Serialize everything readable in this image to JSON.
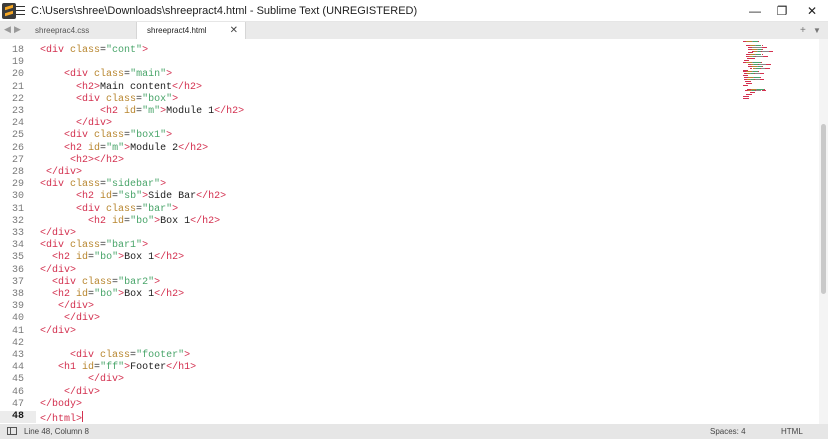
{
  "window": {
    "title": "C:\\Users\\shree\\Downloads\\shreepract4.html - Sublime Text (UNREGISTERED)",
    "minimize": "—",
    "maximize": "❐",
    "close": "✕"
  },
  "tabs": [
    {
      "label": "shreeprac4.css",
      "close": "",
      "active": false
    },
    {
      "label": "shreepract4.html",
      "close": "✕",
      "active": true
    }
  ],
  "tab_nav": {
    "prev": "◀",
    "next": "▶",
    "add": "+",
    "menu": "▼"
  },
  "editor": {
    "current_line": 48,
    "lines": [
      {
        "n": "18",
        "tokens": [
          [
            "tag",
            "<div"
          ],
          [
            "attr",
            " class"
          ],
          [
            "punc",
            "="
          ],
          [
            "str",
            "\"cont\""
          ],
          [
            "tag",
            ">"
          ]
        ]
      },
      {
        "n": "19",
        "tokens": []
      },
      {
        "n": "20",
        "tokens": [
          [
            "text",
            "    "
          ],
          [
            "tag",
            "<div"
          ],
          [
            "attr",
            " class"
          ],
          [
            "punc",
            "="
          ],
          [
            "str",
            "\"main\""
          ],
          [
            "tag",
            ">"
          ]
        ]
      },
      {
        "n": "21",
        "tokens": [
          [
            "text",
            "      "
          ],
          [
            "tag",
            "<h2>"
          ],
          [
            "text",
            "Main content"
          ],
          [
            "tag",
            "</h2>"
          ]
        ]
      },
      {
        "n": "22",
        "tokens": [
          [
            "text",
            "      "
          ],
          [
            "tag",
            "<div"
          ],
          [
            "attr",
            " class"
          ],
          [
            "punc",
            "="
          ],
          [
            "str",
            "\"box\""
          ],
          [
            "tag",
            ">"
          ]
        ]
      },
      {
        "n": "23",
        "tokens": [
          [
            "text",
            "          "
          ],
          [
            "tag",
            "<h2"
          ],
          [
            "attr",
            " id"
          ],
          [
            "punc",
            "="
          ],
          [
            "str",
            "\"m\""
          ],
          [
            "tag",
            ">"
          ],
          [
            "text",
            "Module 1"
          ],
          [
            "tag",
            "</h2>"
          ]
        ]
      },
      {
        "n": "24",
        "tokens": [
          [
            "text",
            "      "
          ],
          [
            "tag",
            "</div>"
          ]
        ]
      },
      {
        "n": "25",
        "tokens": [
          [
            "text",
            "    "
          ],
          [
            "tag",
            "<div"
          ],
          [
            "attr",
            " class"
          ],
          [
            "punc",
            "="
          ],
          [
            "str",
            "\"box1\""
          ],
          [
            "tag",
            ">"
          ]
        ]
      },
      {
        "n": "26",
        "tokens": [
          [
            "text",
            "    "
          ],
          [
            "tag",
            "<h2"
          ],
          [
            "attr",
            " id"
          ],
          [
            "punc",
            "="
          ],
          [
            "str",
            "\"m\""
          ],
          [
            "tag",
            ">"
          ],
          [
            "text",
            "Module 2"
          ],
          [
            "tag",
            "</h2>"
          ]
        ]
      },
      {
        "n": "27",
        "tokens": [
          [
            "text",
            "     "
          ],
          [
            "tag",
            "<h2></h2>"
          ]
        ]
      },
      {
        "n": "28",
        "tokens": [
          [
            "text",
            " "
          ],
          [
            "tag",
            "</div>"
          ]
        ]
      },
      {
        "n": "29",
        "tokens": [
          [
            "tag",
            "<div"
          ],
          [
            "attr",
            " class"
          ],
          [
            "punc",
            "="
          ],
          [
            "str",
            "\"sidebar\""
          ],
          [
            "tag",
            ">"
          ]
        ]
      },
      {
        "n": "30",
        "tokens": [
          [
            "text",
            "      "
          ],
          [
            "tag",
            "<h2"
          ],
          [
            "attr",
            " id"
          ],
          [
            "punc",
            "="
          ],
          [
            "str",
            "\"sb\""
          ],
          [
            "tag",
            ">"
          ],
          [
            "text",
            "Side Bar"
          ],
          [
            "tag",
            "</h2>"
          ]
        ]
      },
      {
        "n": "31",
        "tokens": [
          [
            "text",
            "      "
          ],
          [
            "tag",
            "<div"
          ],
          [
            "attr",
            " class"
          ],
          [
            "punc",
            "="
          ],
          [
            "str",
            "\"bar\""
          ],
          [
            "tag",
            ">"
          ]
        ]
      },
      {
        "n": "32",
        "tokens": [
          [
            "text",
            "        "
          ],
          [
            "tag",
            "<h2"
          ],
          [
            "attr",
            " id"
          ],
          [
            "punc",
            "="
          ],
          [
            "str",
            "\"bo\""
          ],
          [
            "tag",
            ">"
          ],
          [
            "text",
            "Box 1"
          ],
          [
            "tag",
            "</h2>"
          ]
        ]
      },
      {
        "n": "33",
        "tokens": [
          [
            "tag",
            "</div>"
          ]
        ]
      },
      {
        "n": "34",
        "tokens": [
          [
            "tag",
            "<div"
          ],
          [
            "attr",
            " class"
          ],
          [
            "punc",
            "="
          ],
          [
            "str",
            "\"bar1\""
          ],
          [
            "tag",
            ">"
          ]
        ]
      },
      {
        "n": "35",
        "tokens": [
          [
            "text",
            "  "
          ],
          [
            "tag",
            "<h2"
          ],
          [
            "attr",
            " id"
          ],
          [
            "punc",
            "="
          ],
          [
            "str",
            "\"bo\""
          ],
          [
            "tag",
            ">"
          ],
          [
            "text",
            "Box 1"
          ],
          [
            "tag",
            "</h2>"
          ]
        ]
      },
      {
        "n": "36",
        "tokens": [
          [
            "tag",
            "</div>"
          ]
        ]
      },
      {
        "n": "37",
        "tokens": [
          [
            "text",
            "  "
          ],
          [
            "tag",
            "<div"
          ],
          [
            "attr",
            " class"
          ],
          [
            "punc",
            "="
          ],
          [
            "str",
            "\"bar2\""
          ],
          [
            "tag",
            ">"
          ]
        ]
      },
      {
        "n": "38",
        "tokens": [
          [
            "text",
            "  "
          ],
          [
            "tag",
            "<h2"
          ],
          [
            "attr",
            " id"
          ],
          [
            "punc",
            "="
          ],
          [
            "str",
            "\"bo\""
          ],
          [
            "tag",
            ">"
          ],
          [
            "text",
            "Box 1"
          ],
          [
            "tag",
            "</h2>"
          ]
        ]
      },
      {
        "n": "39",
        "tokens": [
          [
            "text",
            "   "
          ],
          [
            "tag",
            "</div>"
          ]
        ]
      },
      {
        "n": "40",
        "tokens": [
          [
            "text",
            "    "
          ],
          [
            "tag",
            "</div>"
          ]
        ]
      },
      {
        "n": "41",
        "tokens": [
          [
            "tag",
            "</div>"
          ]
        ]
      },
      {
        "n": "42",
        "tokens": []
      },
      {
        "n": "43",
        "tokens": [
          [
            "text",
            "     "
          ],
          [
            "tag",
            "<div"
          ],
          [
            "attr",
            " class"
          ],
          [
            "punc",
            "="
          ],
          [
            "str",
            "\"footer\""
          ],
          [
            "tag",
            ">"
          ]
        ]
      },
      {
        "n": "44",
        "tokens": [
          [
            "text",
            "   "
          ],
          [
            "tag",
            "<h1"
          ],
          [
            "attr",
            " id"
          ],
          [
            "punc",
            "="
          ],
          [
            "str",
            "\"ff\""
          ],
          [
            "tag",
            ">"
          ],
          [
            "text",
            "Footer"
          ],
          [
            "tag",
            "</h1>"
          ]
        ]
      },
      {
        "n": "45",
        "tokens": [
          [
            "text",
            "        "
          ],
          [
            "tag",
            "</div>"
          ]
        ]
      },
      {
        "n": "46",
        "tokens": [
          [
            "text",
            "    "
          ],
          [
            "tag",
            "</div>"
          ]
        ]
      },
      {
        "n": "47",
        "tokens": [
          [
            "tag",
            "</body>"
          ]
        ]
      },
      {
        "n": "48",
        "tokens": [
          [
            "tag",
            "</html>"
          ]
        ]
      }
    ]
  },
  "statusbar": {
    "position": "Line 48, Column 8",
    "spaces": "Spaces: 4",
    "syntax": "HTML"
  },
  "colors": {
    "tag": "#d3304f",
    "attr": "#b8862f",
    "string": "#49a56a",
    "text": "#1e1e1e"
  }
}
